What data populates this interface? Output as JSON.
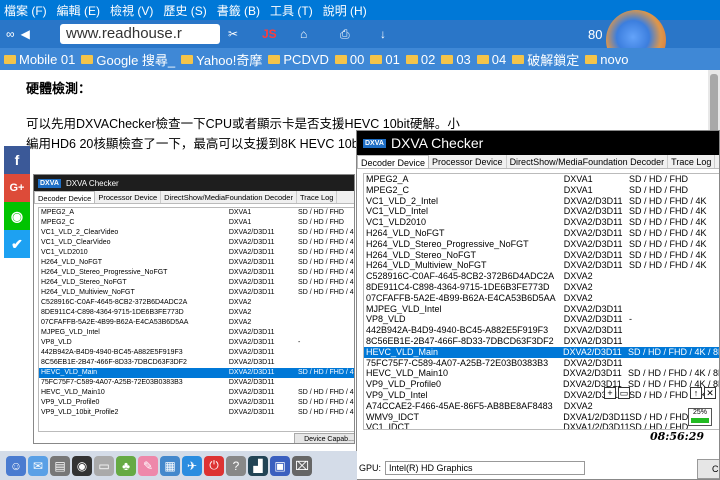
{
  "browser": {
    "menu": [
      "檔案 (F)",
      "編輯 (E)",
      "檢視 (V)",
      "歷史 (S)",
      "書籤 (B)",
      "工具 (T)",
      "說明 (H)"
    ],
    "url": "www.readhouse.r",
    "zoom": "80",
    "bookmarks": [
      "Mobile 01",
      "Google 搜尋_",
      "Yahoo!奇摩",
      "PCDVD",
      "00",
      "01",
      "02",
      "03",
      "04",
      "破解鎖定",
      "novo"
    ]
  },
  "article": {
    "heading": "硬體檢測：",
    "paragraph": "可以先用DXVAChecker檢查一下CPU或者顯示卡是否支援HEVC 10bit硬解。小編用HD6 20核顯檢查了一下，最高可以支援到8K HEVC 10bit硬體。",
    "share": [
      "f",
      "G+",
      "◉",
      "✔"
    ]
  },
  "small_dxva": {
    "title": "DXVA Checker",
    "badge": "DXVA",
    "tabs": [
      "Decoder Device",
      "Processor Device",
      "DirectShow/MediaFoundation Decoder",
      "Trace Log"
    ],
    "rows": [
      [
        "MPEG2_A",
        "DXVA1",
        "SD / HD / FHD"
      ],
      [
        "MPEG2_C",
        "DXVA1",
        "SD / HD / FHD"
      ],
      [
        "VC1_VLD_2_ClearVideo",
        "DXVA2/D3D11",
        "SD / HD / FHD / 4K"
      ],
      [
        "VC1_VLD_ClearVideo",
        "DXVA2/D3D11",
        "SD / HD / FHD / 4K"
      ],
      [
        "VC1_VLD2010",
        "DXVA2/D3D11",
        "SD / HD / FHD / 4K"
      ],
      [
        "H264_VLD_NoFGT",
        "DXVA2/D3D11",
        "SD / HD / FHD / 4K"
      ],
      [
        "H264_VLD_Stereo_Progressive_NoFGT",
        "DXVA2/D3D11",
        "SD / HD / FHD / 4K"
      ],
      [
        "H264_VLD_Stereo_NoFGT",
        "DXVA2/D3D11",
        "SD / HD / FHD / 4K"
      ],
      [
        "H264_VLD_Multiview_NoFGT",
        "DXVA2/D3D11",
        "SD / HD / FHD / 4K"
      ],
      [
        "C528916C-C0AF-4645-8CB2-372B6D4ADC2A",
        "DXVA2",
        ""
      ],
      [
        "8DE911C4-C898-4364-9715-1DE6B3FE773D",
        "DXVA2",
        ""
      ],
      [
        "07CFAFFB-5A2E-4B99-B62A-E4CA53B6D5AA",
        "DXVA2",
        ""
      ],
      [
        "MJPEG_VLD_Intel",
        "DXVA2/D3D11",
        ""
      ],
      [
        "VP8_VLD",
        "DXVA2/D3D11",
        "-"
      ],
      [
        "442B942A-B4D9-4940-BC45-A882E5F919F3",
        "DXVA2/D3D11",
        ""
      ],
      [
        "8C56EB1E-2B47-466F-8D33-7DBCD63F3DF2",
        "DXVA2/D3D11",
        ""
      ],
      [
        "HEVC_VLD_Main",
        "DXVA2/D3D11",
        "SD / HD / FHD / 4K / 8K"
      ],
      [
        "75FC75F7-C589-4A07-A25B-72E03B0383B3",
        "DXVA2/D3D11",
        ""
      ],
      [
        "HEVC_VLD_Main10",
        "DXVA2/D3D11",
        "SD / HD / FHD / 4K / 8K"
      ],
      [
        "VP9_VLD_Profile0",
        "DXVA2/D3D11",
        "SD / HD / FHD / 4K / 8K"
      ],
      [
        "VP9_VLD_10bit_Profile2",
        "DXVA2/D3D11",
        "SD / HD / FHD / 4K / 8K"
      ]
    ],
    "selected_index": 16,
    "button": "Device Capab..."
  },
  "big_dxva": {
    "title": "DXVA Checker",
    "badge": "DXVA",
    "tabs": [
      "Decoder Device",
      "Processor Device",
      "DirectShow/MediaFoundation Decoder",
      "Trace Log"
    ],
    "rows": [
      [
        "MPEG2_A",
        "DXVA1",
        "SD / HD / FHD"
      ],
      [
        "MPEG2_C",
        "DXVA1",
        "SD / HD / FHD"
      ],
      [
        "VC1_VLD_2_Intel",
        "DXVA2/D3D11",
        "SD / HD / FHD / 4K"
      ],
      [
        "VC1_VLD_Intel",
        "DXVA2/D3D11",
        "SD / HD / FHD / 4K"
      ],
      [
        "VC1_VLD2010",
        "DXVA2/D3D11",
        "SD / HD / FHD / 4K"
      ],
      [
        "H264_VLD_NoFGT",
        "DXVA2/D3D11",
        "SD / HD / FHD / 4K"
      ],
      [
        "H264_VLD_Stereo_Progressive_NoFGT",
        "DXVA2/D3D11",
        "SD / HD / FHD / 4K"
      ],
      [
        "H264_VLD_Stereo_NoFGT",
        "DXVA2/D3D11",
        "SD / HD / FHD / 4K"
      ],
      [
        "H264_VLD_Multiview_NoFGT",
        "DXVA2/D3D11",
        "SD / HD / FHD / 4K"
      ],
      [
        "C528916C-C0AF-4645-8CB2-372B6D4ADC2A",
        "DXVA2",
        ""
      ],
      [
        "8DE911C4-C898-4364-9715-1DE6B3FE773D",
        "DXVA2",
        ""
      ],
      [
        "07CFAFFB-5A2E-4B99-B62A-E4CA53B6D5AA",
        "DXVA2",
        ""
      ],
      [
        "MJPEG_VLD_Intel",
        "DXVA2/D3D11",
        ""
      ],
      [
        "VP8_VLD",
        "DXVA2/D3D11",
        "-"
      ],
      [
        "442B942A-B4D9-4940-BC45-A882E5F919F3",
        "DXVA2/D3D11",
        ""
      ],
      [
        "8C56EB1E-2B47-466F-8D33-7DBCD63F3DF2",
        "DXVA2/D3D11",
        ""
      ],
      [
        "HEVC_VLD_Main",
        "DXVA2/D3D11",
        "SD / HD / FHD / 4K / 8K"
      ],
      [
        "75FC75F7-C589-4A07-A25B-72E03B0383B3",
        "DXVA2/D3D11",
        ""
      ],
      [
        "HEVC_VLD_Main10",
        "DXVA2/D3D11",
        "SD / HD / FHD / 4K / 8K"
      ],
      [
        "VP9_VLD_Profile0",
        "DXVA2/D3D11",
        "SD / HD / FHD / 4K / 8K"
      ],
      [
        "VP9_VLD_Intel",
        "DXVA2/D3D11",
        "SD / HD / FHD / 4K"
      ],
      [
        "A74CCAE2-F466-45AE-86F5-AB8BE8AF8483",
        "DXVA2",
        ""
      ],
      [
        "WMV9_IDCT",
        "DXVA1/2/D3D11",
        "SD / HD / FHD"
      ],
      [
        "VC1_IDCT",
        "DXVA1/2/D3D11",
        "SD / HD / FHD"
      ]
    ],
    "selected_index": 16,
    "gpu_label": "GPU:",
    "gpu_value": "Intel(R) HD Graphics",
    "ok_button": "Cl"
  },
  "tray": {
    "clock": "08:56:29",
    "meter": "25%"
  },
  "colors": {
    "menubar": "#0078d7",
    "toolbar": "#2a76c8",
    "bookmarks": "#3f88d6",
    "selection": "#0078d7"
  }
}
